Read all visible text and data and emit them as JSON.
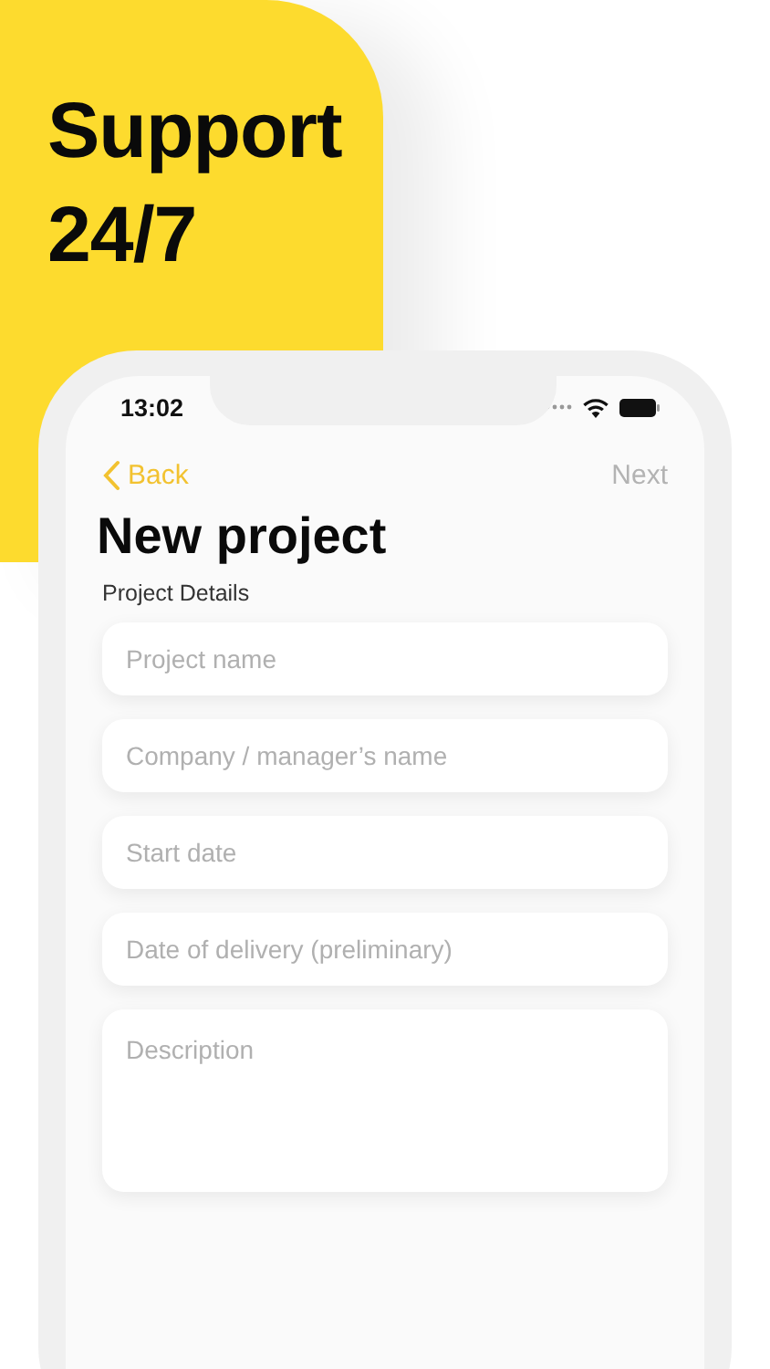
{
  "headline": [
    "Support",
    "24/7"
  ],
  "status_bar": {
    "time": "13:02"
  },
  "nav": {
    "back": "Back",
    "next": {
      "label": "Next",
      "disabled": true
    }
  },
  "title": "New project",
  "section": "Project Details",
  "fields": [
    {
      "kind": "line",
      "placeholder": "Project name"
    },
    {
      "kind": "line",
      "placeholder": "Company / manager’s name"
    },
    {
      "kind": "line",
      "placeholder": "Start date"
    },
    {
      "kind": "line",
      "placeholder": "Date of delivery (preliminary)"
    },
    {
      "kind": "area",
      "placeholder": "Description"
    }
  ]
}
